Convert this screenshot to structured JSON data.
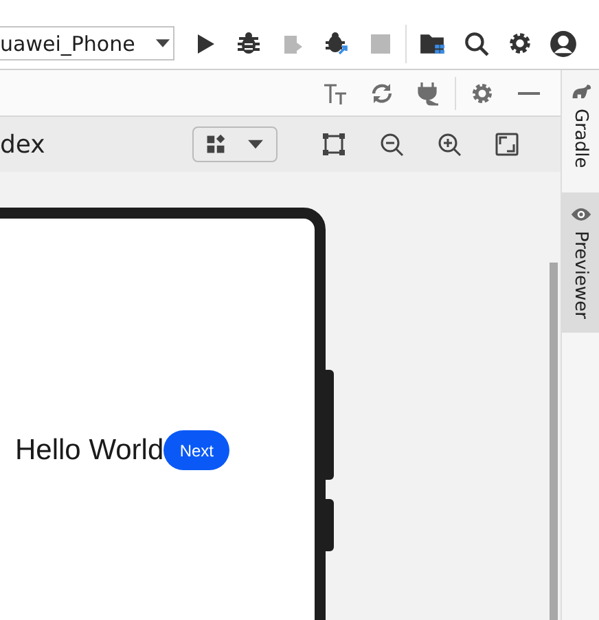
{
  "toolbar": {
    "device_selector": {
      "value": "uawei_Phone"
    },
    "actions": [
      {
        "kind": "run",
        "disabled": false
      },
      {
        "kind": "debug",
        "disabled": false
      },
      {
        "kind": "coverage",
        "disabled": true
      },
      {
        "kind": "attach",
        "disabled": false
      },
      {
        "kind": "stop",
        "disabled": true
      }
    ],
    "tools": [
      {
        "kind": "folder"
      },
      {
        "kind": "search"
      },
      {
        "kind": "settings"
      },
      {
        "kind": "account"
      }
    ]
  },
  "preview_panel": {
    "tab_title": "dex",
    "header_tools": [
      {
        "kind": "font"
      },
      {
        "kind": "refresh"
      },
      {
        "kind": "plug"
      },
      {
        "kind": "settings"
      },
      {
        "kind": "minimize"
      }
    ],
    "view_tools": [
      {
        "kind": "frame"
      },
      {
        "kind": "zoom-out"
      },
      {
        "kind": "zoom-in"
      },
      {
        "kind": "fit"
      }
    ],
    "screen": {
      "text": "Hello World",
      "button": "Next"
    }
  },
  "side_tabs": [
    {
      "label": "Gradle",
      "kind": "gradle",
      "selected": false
    },
    {
      "label": "Previewer",
      "kind": "eye",
      "selected": true
    }
  ]
}
